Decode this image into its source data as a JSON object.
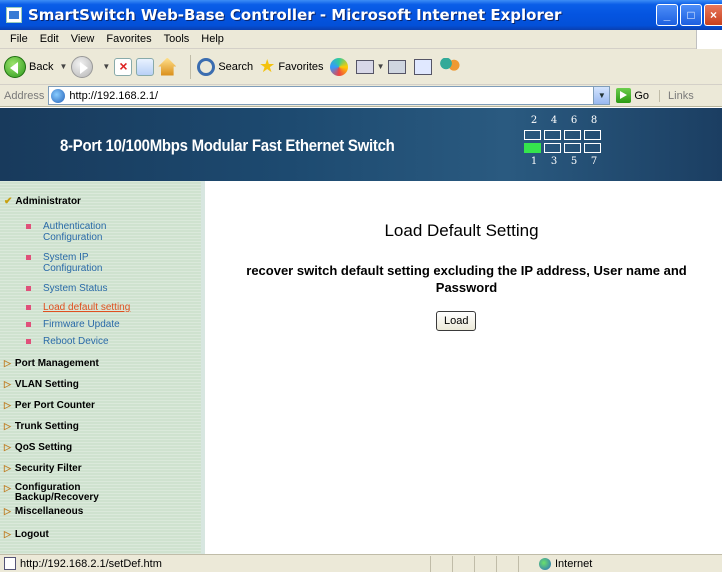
{
  "window": {
    "title": "SmartSwitch Web-Base Controller - Microsoft Internet Explorer"
  },
  "menu": {
    "items": [
      "File",
      "Edit",
      "View",
      "Favorites",
      "Tools",
      "Help"
    ]
  },
  "toolbar": {
    "back": "Back",
    "search": "Search",
    "favorites": "Favorites"
  },
  "address": {
    "label": "Address",
    "url": "http://192.168.2.1/",
    "go": "Go",
    "links": "Links"
  },
  "banner": {
    "title": "8-Port 10/100Mbps Modular Fast Ethernet Switch",
    "port_top_numbers": [
      "2",
      "4",
      "6",
      "8"
    ],
    "port_bottom_numbers": [
      "1",
      "3",
      "5",
      "7"
    ]
  },
  "nav": {
    "admin": "Administrator",
    "sub": {
      "auth": [
        "Authentication",
        "Configuration"
      ],
      "ip": [
        "System IP",
        "Configuration"
      ],
      "status": "System Status",
      "load": "Load default setting",
      "firmware": "Firmware Update",
      "reboot": "Reboot Device"
    },
    "port_mgmt": "Port Management",
    "vlan": "VLAN Setting",
    "counter": "Per Port Counter",
    "trunk": "Trunk Setting",
    "qos": "QoS Setting",
    "security": "Security Filter",
    "config": [
      "Configuration",
      "Backup/Recovery"
    ],
    "misc": "Miscellaneous",
    "logout": "Logout"
  },
  "main": {
    "title": "Load Default Setting",
    "desc": [
      "recover switch default setting excluding the IP address, User name and",
      "Password"
    ],
    "button": "Load"
  },
  "status": {
    "url": "http://192.168.2.1/setDef.htm",
    "zone": "Internet"
  }
}
